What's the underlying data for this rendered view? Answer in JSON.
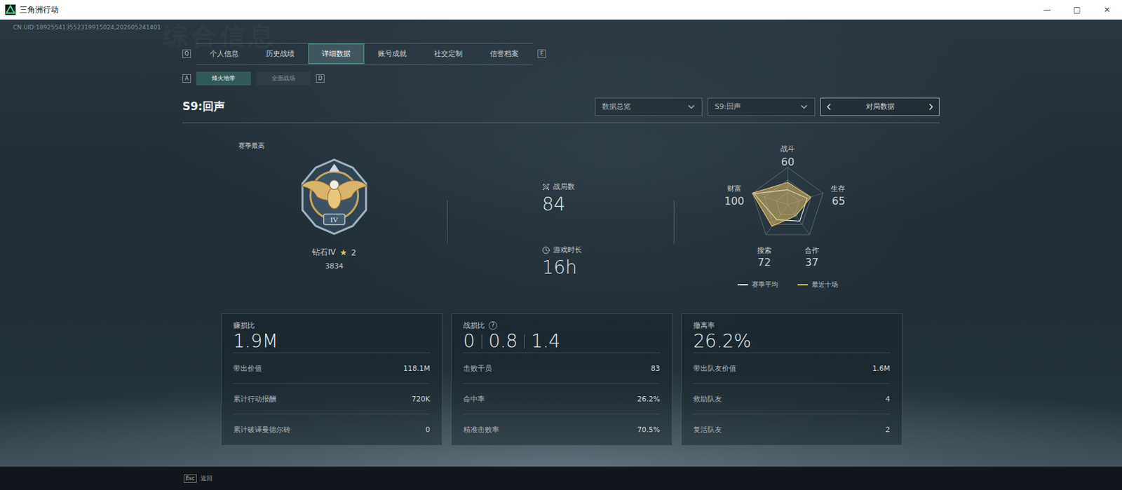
{
  "window": {
    "title": "三角洲行动",
    "controls": [
      "—",
      "□",
      "✕"
    ]
  },
  "uid": "CN.UID:189255413552319915024,202605241401",
  "watermark": "综合信息",
  "tabs": {
    "prev_key": "Q",
    "next_key": "E",
    "items": [
      {
        "label": "个人信息",
        "selected": false
      },
      {
        "label": "历史战绩",
        "selected": false
      },
      {
        "label": "详细数据",
        "selected": true
      },
      {
        "label": "账号成就",
        "selected": false
      },
      {
        "label": "社交定制",
        "selected": false
      },
      {
        "label": "信誉档案",
        "selected": false
      }
    ]
  },
  "subtabs": {
    "prev_key": "A",
    "next_key": "D",
    "items": [
      {
        "label": "烽火地带",
        "selected": true
      },
      {
        "label": "全面战场",
        "selected": false
      }
    ]
  },
  "section_title": "S9:回声",
  "filters": [
    {
      "label": "数据总览",
      "kind": "dropdown"
    },
    {
      "label": "S9:回声",
      "kind": "dropdown"
    },
    {
      "label": "对局数据",
      "kind": "pager"
    }
  ],
  "rank": {
    "caption": "赛季最高",
    "numeral": "IV",
    "name": "钻石IV",
    "star": "★",
    "stars": "2",
    "score": "3834"
  },
  "stats": [
    {
      "label": "战局数",
      "value": "84",
      "kind": "swords"
    },
    {
      "label": "游戏时长",
      "value": "16h",
      "kind": "clock"
    }
  ],
  "radar": {
    "max": 100,
    "axes": [
      {
        "label": "战斗",
        "value": "60"
      },
      {
        "label": "生存",
        "value": "65"
      },
      {
        "label": "合作",
        "value": "37"
      },
      {
        "label": "搜索",
        "value": "72"
      },
      {
        "label": "财富",
        "value": "100"
      }
    ],
    "series": [
      {
        "name": "赛季平均",
        "values": [
          40,
          55,
          55,
          50,
          95
        ],
        "color": "#e6ecef"
      },
      {
        "name": "最近十场",
        "values": [
          60,
          65,
          37,
          72,
          100
        ],
        "color": "#e0c06a"
      }
    ]
  },
  "cards": [
    {
      "title": "赚损比",
      "values": [
        "1.9M"
      ],
      "rows": [
        {
          "label": "带出价值",
          "value": "118.1M"
        },
        {
          "label": "累计行动报酬",
          "value": "720K"
        },
        {
          "label": "累计破译曼德尔砖",
          "value": "0"
        }
      ]
    },
    {
      "title": "战损比",
      "help": "?",
      "values": [
        "0",
        "0.8",
        "1.4"
      ],
      "rows": [
        {
          "label": "击败干员",
          "value": "83"
        },
        {
          "label": "命中率",
          "value": "26.2%"
        },
        {
          "label": "精准击败率",
          "value": "70.5%"
        }
      ]
    },
    {
      "title": "撤离率",
      "values": [
        "26.2%"
      ],
      "rows": [
        {
          "label": "带出队友价值",
          "value": "1.6M"
        },
        {
          "label": "救助队友",
          "value": "4"
        },
        {
          "label": "复活队友",
          "value": "2"
        }
      ]
    }
  ],
  "footer": {
    "key": "Esc",
    "label": "返回"
  }
}
